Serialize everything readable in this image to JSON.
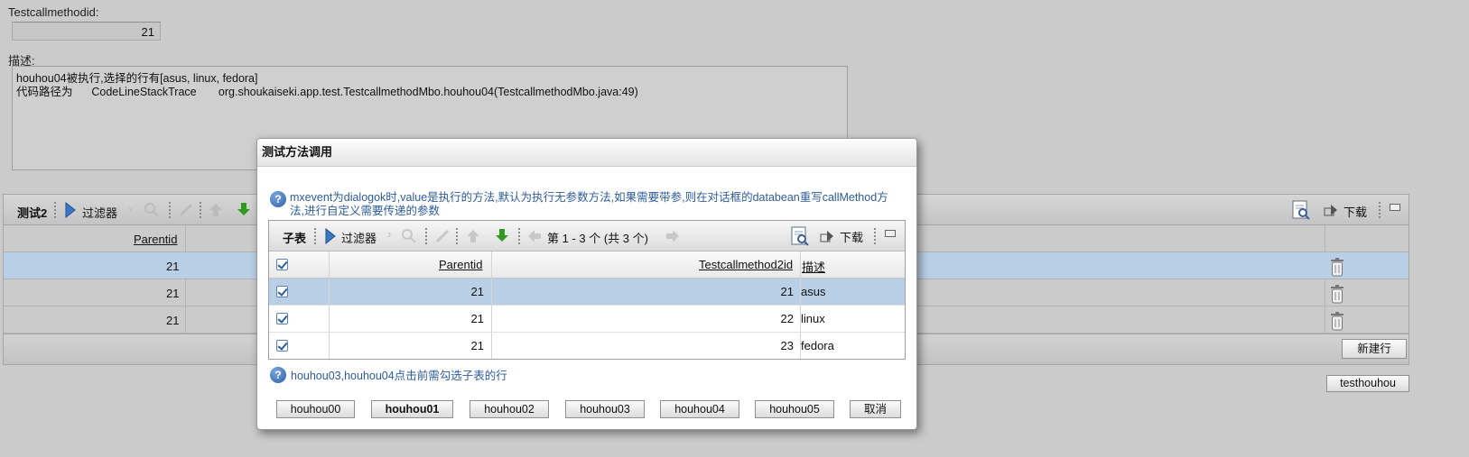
{
  "form": {
    "testcallmethodid_label": "Testcallmethodid:",
    "testcallmethodid_value": "21",
    "desc_label": "描述:",
    "desc_line1": "houhou04被执行,选择的行有[asus, linux, fedora]",
    "desc_line2": "代码路径为      CodeLineStackTrace       org.shoukaiseki.app.test.TestcallmethodMbo.houhou04(TestcallmethodMbo.java:49)"
  },
  "bg_table": {
    "title": "测试2",
    "filter_label": "过滤器",
    "download_label": "下载",
    "column_parentid": "Parentid",
    "rows": [
      {
        "parentid": "21"
      },
      {
        "parentid": "21"
      },
      {
        "parentid": "21"
      }
    ],
    "new_row_button": "新建行"
  },
  "testhouhou_button": "testhouhou",
  "dialog": {
    "title": "测试方法调用",
    "info_line1": "mxevent为dialogok时,value是执行的方法,默认为执行无参数方法,如果需要带参,则在对话框的databean重写callMethod方",
    "info_line2": "法,进行自定义需要传递的参数",
    "grid": {
      "title": "子表",
      "filter_label": "过滤器",
      "paging": "第 1 - 3 个 (共 3 个)",
      "download_label": "下载",
      "columns": {
        "parentid": "Parentid",
        "testcallmethod2id": "Testcallmethod2id",
        "desc": "描述"
      },
      "rows": [
        {
          "parentid": "21",
          "testcallmethod2id": "21",
          "desc": "asus"
        },
        {
          "parentid": "21",
          "testcallmethod2id": "22",
          "desc": "linux"
        },
        {
          "parentid": "21",
          "testcallmethod2id": "23",
          "desc": "fedora"
        }
      ]
    },
    "note": "houhou03,houhou04点击前需勾选子表的行",
    "buttons": [
      "houhou00",
      "houhou01",
      "houhou02",
      "houhou03",
      "houhou04",
      "houhou05",
      "取消"
    ]
  },
  "colors": {
    "selected_row": "#b9cfe6",
    "info_text": "#2e5c9a",
    "accent_green": "#2f9a1e"
  }
}
